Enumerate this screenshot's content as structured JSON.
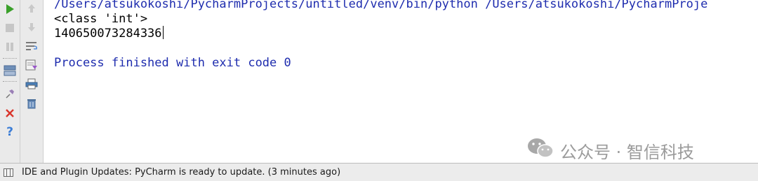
{
  "console": {
    "command_line": "/Users/atsukokoshi/PycharmProjects/untitled/venv/bin/python /Users/atsukokoshi/PycharmProje",
    "output_lines": [
      "<class 'int'>",
      "140650073284336"
    ],
    "process_message": "Process finished with exit code 0"
  },
  "watermark": {
    "text": "公众号 · 智信科技"
  },
  "statusbar": {
    "message": "IDE and Plugin Updates: PyCharm is ready to update. (3 minutes ago)"
  },
  "colors": {
    "run_green": "#3aa02a",
    "console_blue": "#1e2cae",
    "close_red": "#d9352b",
    "help_blue": "#3d7ed6"
  },
  "icons": {
    "left_toolbar": [
      "run-icon",
      "stop-icon",
      "pause-icon",
      "layout-icon",
      "pin-icon",
      "close-icon",
      "help-icon"
    ],
    "right_toolbar": [
      "up-arrow-icon",
      "down-arrow-icon",
      "soft-wrap-icon",
      "scroll-to-end-icon",
      "print-icon",
      "trash-icon"
    ]
  }
}
